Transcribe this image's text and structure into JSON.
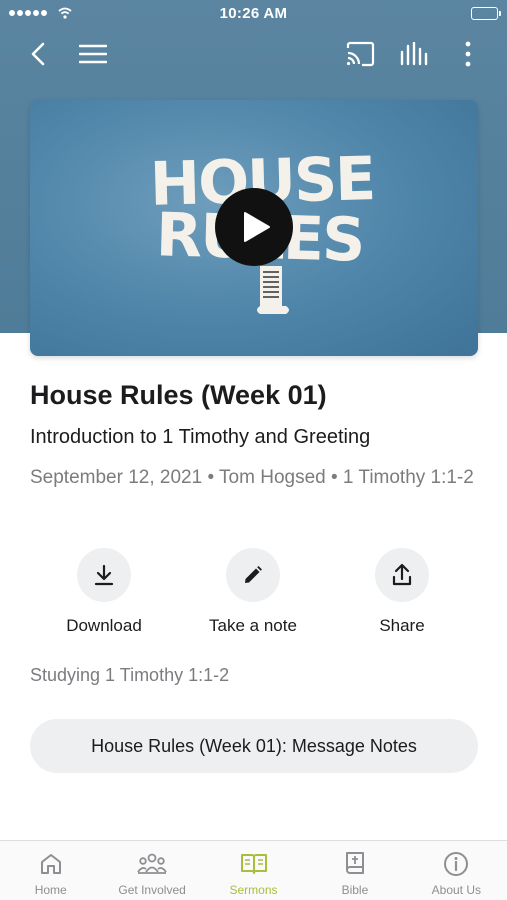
{
  "status_bar": {
    "time": "10:26 AM"
  },
  "video": {
    "art_line1": "HOUSE",
    "art_line2": "RULES"
  },
  "sermon": {
    "title": "House Rules (Week 01)",
    "subtitle": "Introduction to 1 Timothy and Greeting",
    "meta": "September 12, 2021 • Tom Hogsed • 1 Timothy 1:1-2"
  },
  "actions": [
    {
      "label": "Download",
      "icon": "download-icon"
    },
    {
      "label": "Take a note",
      "icon": "pencil-icon"
    },
    {
      "label": "Share",
      "icon": "share-icon"
    }
  ],
  "studying": "Studying 1 Timothy 1:1-2",
  "notes_button": "House Rules (Week 01): Message Notes",
  "tabs": [
    {
      "label": "Home",
      "icon": "home-icon",
      "active": false
    },
    {
      "label": "Get Involved",
      "icon": "people-icon",
      "active": false
    },
    {
      "label": "Sermons",
      "icon": "book-open-icon",
      "active": true
    },
    {
      "label": "Bible",
      "icon": "bible-icon",
      "active": false
    },
    {
      "label": "About Us",
      "icon": "info-icon",
      "active": false
    }
  ],
  "colors": {
    "header_blue": "#5b85a1",
    "accent": "#a9be3a",
    "muted_text": "#7c7c80"
  }
}
